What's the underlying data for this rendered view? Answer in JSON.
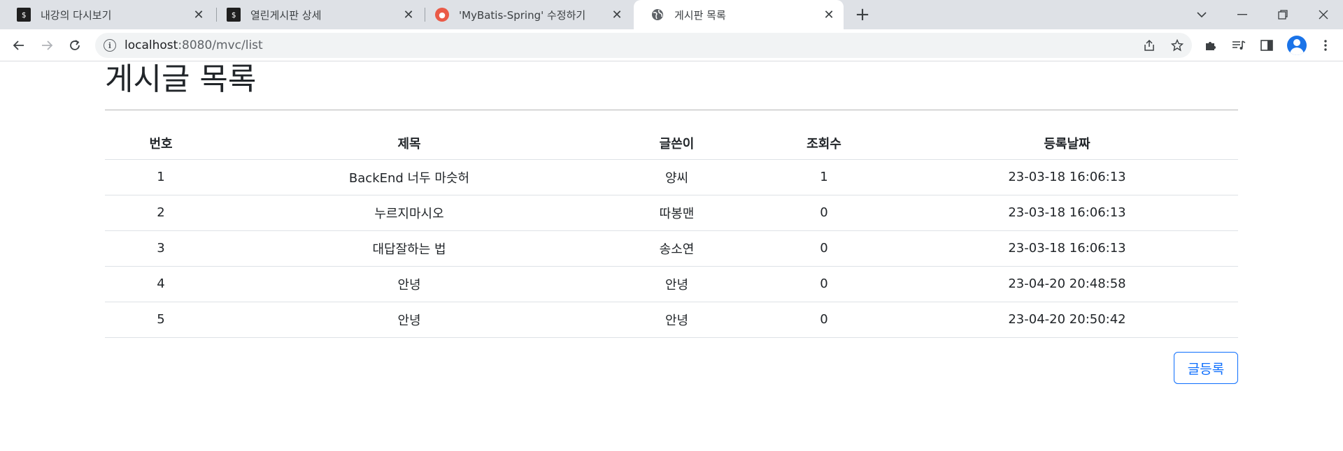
{
  "browser": {
    "tabs": [
      {
        "title": "내강의 다시보기",
        "favicon": "dark-s-favicon",
        "active": false
      },
      {
        "title": "열린게시판 상세",
        "favicon": "dark-s-favicon",
        "active": false
      },
      {
        "title": "'MyBatis-Spring' 수정하기",
        "favicon": "red-mascot-favicon",
        "active": false
      },
      {
        "title": "게시판 목록",
        "favicon": "globe-icon",
        "active": true
      }
    ],
    "url_host": "localhost",
    "url_path": ":8080/mvc/list"
  },
  "page": {
    "title": "게시글 목록",
    "table": {
      "headers": [
        "번호",
        "제목",
        "글쓴이",
        "조회수",
        "등록날짜"
      ],
      "rows": [
        [
          "1",
          "BackEnd 너두 마슷허",
          "양씨",
          "1",
          "23-03-18 16:06:13"
        ],
        [
          "2",
          "누르지마시오",
          "따봉맨",
          "0",
          "23-03-18 16:06:13"
        ],
        [
          "3",
          "대답잘하는 법",
          "송소연",
          "0",
          "23-03-18 16:06:13"
        ],
        [
          "4",
          "안녕",
          "안녕",
          "0",
          "23-04-20 20:48:58"
        ],
        [
          "5",
          "안녕",
          "안녕",
          "0",
          "23-04-20 20:50:42"
        ]
      ]
    },
    "register_button": "글등록"
  },
  "colors": {
    "accent": "#0d6efd",
    "tabstrip": "#dee1e6",
    "text": "#212529"
  }
}
